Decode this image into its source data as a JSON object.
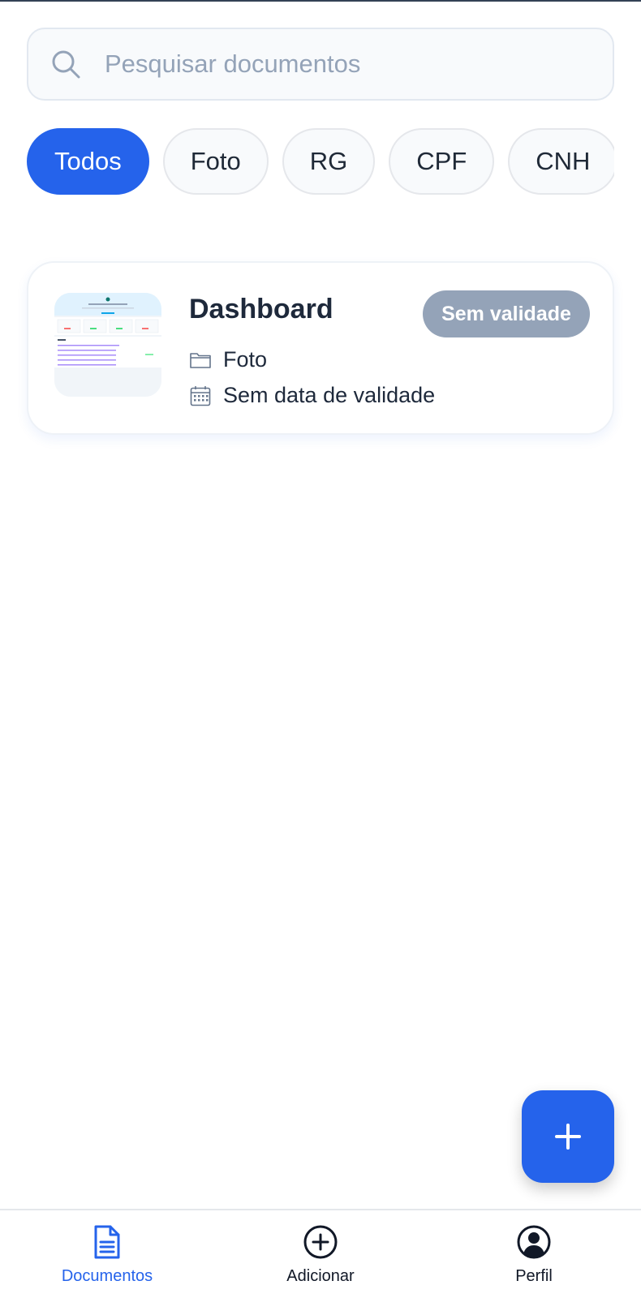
{
  "search": {
    "placeholder": "Pesquisar documentos"
  },
  "filters": {
    "selected": "Todos",
    "items": [
      {
        "label": "Todos",
        "active": true
      },
      {
        "label": "Foto",
        "active": false
      },
      {
        "label": "RG",
        "active": false
      },
      {
        "label": "CPF",
        "active": false
      },
      {
        "label": "CNH",
        "active": false
      }
    ]
  },
  "documents": [
    {
      "title": "Dashboard",
      "status_badge": "Sem validade",
      "category": "Foto",
      "expiry": "Sem data de validade",
      "thumbnail_icon": "dashboard-screenshot-thumbnail"
    }
  ],
  "fab": {
    "icon": "plus-icon"
  },
  "bottom_nav": {
    "items": [
      {
        "label": "Documentos",
        "icon": "document-icon",
        "active": true
      },
      {
        "label": "Adicionar",
        "icon": "add-circle-icon",
        "active": false
      },
      {
        "label": "Perfil",
        "icon": "profile-icon",
        "active": false
      }
    ]
  },
  "colors": {
    "accent": "#2563eb",
    "badge_neutral": "#94a3b8",
    "text_primary": "#1e293b",
    "placeholder": "#94a3b8"
  }
}
